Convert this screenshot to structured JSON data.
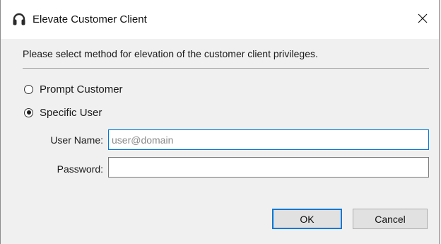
{
  "window": {
    "title": "Elevate Customer Client",
    "icon": "headset-icon",
    "close_glyph": "✕"
  },
  "instruction": "Please select method for elevation of the customer client privileges.",
  "options": [
    {
      "label": "Prompt Customer",
      "checked": false
    },
    {
      "label": "Specific User",
      "checked": true
    }
  ],
  "fields": {
    "username": {
      "label": "User Name:",
      "value": "",
      "placeholder": "user@domain"
    },
    "password": {
      "label": "Password:",
      "value": ""
    }
  },
  "buttons": {
    "ok": "OK",
    "cancel": "Cancel"
  },
  "colors": {
    "accent": "#0078d7",
    "background": "#f0f0f0"
  }
}
